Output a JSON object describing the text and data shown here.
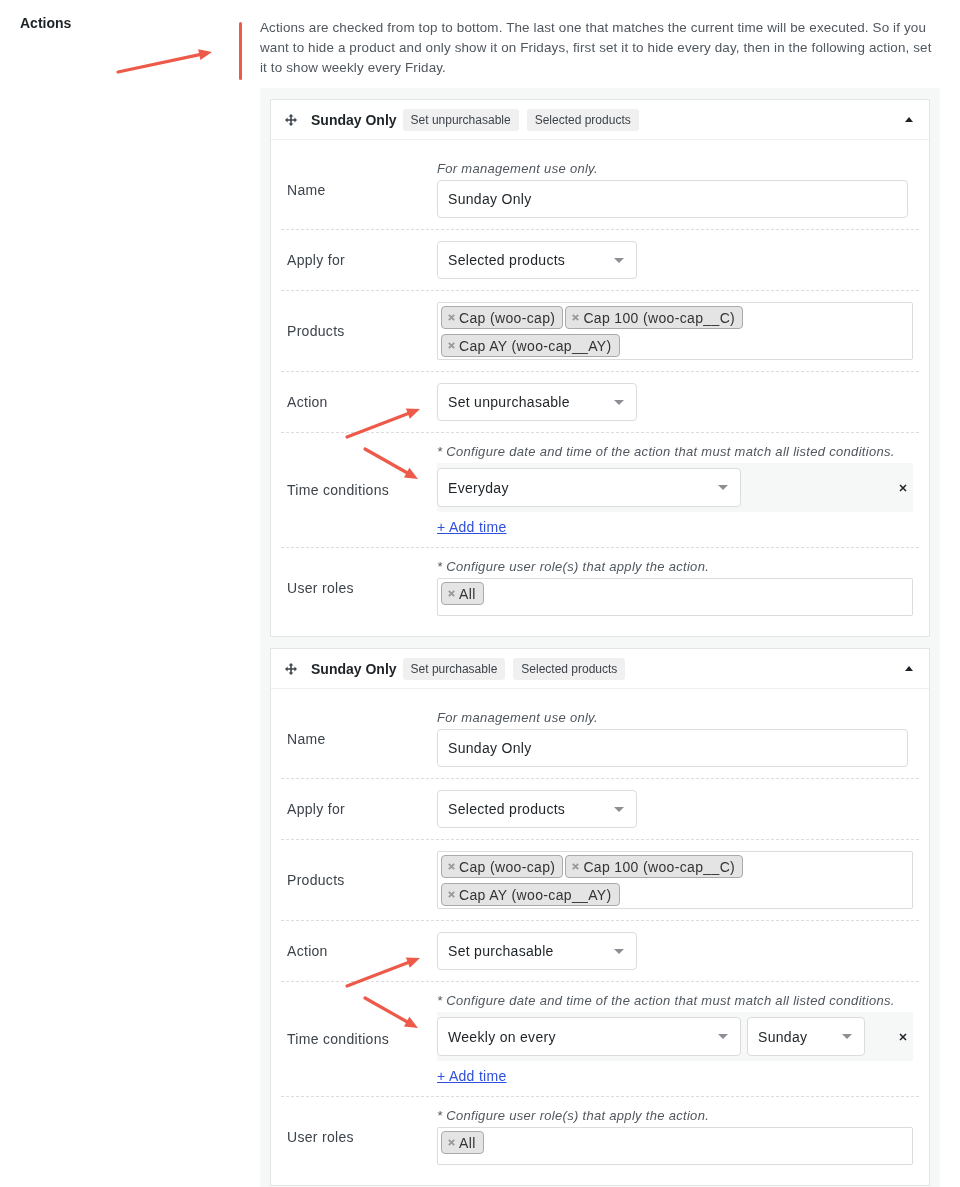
{
  "section": {
    "label": "Actions",
    "description": "Actions are checked from top to bottom. The last one that matches the current time will be executed. So if you want to hide a product and only show it on Fridays, first set it to hide every day, then in the following action, set it to show weekly every Friday.",
    "annotated": true
  },
  "actions": [
    {
      "title": "Sunday Only",
      "badges": [
        "Set unpurchasable",
        "Selected products"
      ],
      "expanded": true,
      "fields": [
        {
          "kind": "text",
          "label": "Name",
          "hint": "For management use only.",
          "value": "Sunday Only",
          "annotated": false
        },
        {
          "kind": "select",
          "label": "Apply for",
          "value": "Selected products",
          "annotated": false
        },
        {
          "kind": "tags",
          "label": "Products",
          "tags": [
            "Cap (woo-cap)",
            "Cap 100 (woo-cap__C)",
            "Cap AY (woo-cap__AY)"
          ],
          "annotated": false
        },
        {
          "kind": "select",
          "label": "Action",
          "value": "Set unpurchasable",
          "annotated": true
        },
        {
          "kind": "time",
          "label": "Time conditions",
          "hint": "* Configure date and time of the action that must match all listed conditions.",
          "conditions": [
            {
              "selects": [
                "Everyday"
              ]
            }
          ],
          "add_link": "+ Add time",
          "annotated": true
        },
        {
          "kind": "tags",
          "label": "User roles",
          "hint": "* Configure user role(s) that apply the action.",
          "tags": [
            "All"
          ],
          "annotated": false
        }
      ]
    },
    {
      "title": "Sunday Only",
      "badges": [
        "Set purchasable",
        "Selected products"
      ],
      "expanded": true,
      "fields": [
        {
          "kind": "text",
          "label": "Name",
          "hint": "For management use only.",
          "value": "Sunday Only",
          "annotated": false
        },
        {
          "kind": "select",
          "label": "Apply for",
          "value": "Selected products",
          "annotated": false
        },
        {
          "kind": "tags",
          "label": "Products",
          "tags": [
            "Cap (woo-cap)",
            "Cap 100 (woo-cap__C)",
            "Cap AY (woo-cap__AY)"
          ],
          "annotated": false
        },
        {
          "kind": "select",
          "label": "Action",
          "value": "Set purchasable",
          "annotated": true
        },
        {
          "kind": "time",
          "label": "Time conditions",
          "hint": "* Configure date and time of the action that must match all listed conditions.",
          "conditions": [
            {
              "selects": [
                "Weekly on every",
                "Sunday"
              ]
            }
          ],
          "add_link": "+ Add time",
          "annotated": true
        },
        {
          "kind": "tags",
          "label": "User roles",
          "hint": "* Configure user role(s) that apply the action.",
          "tags": [
            "All"
          ],
          "annotated": false
        }
      ]
    }
  ]
}
